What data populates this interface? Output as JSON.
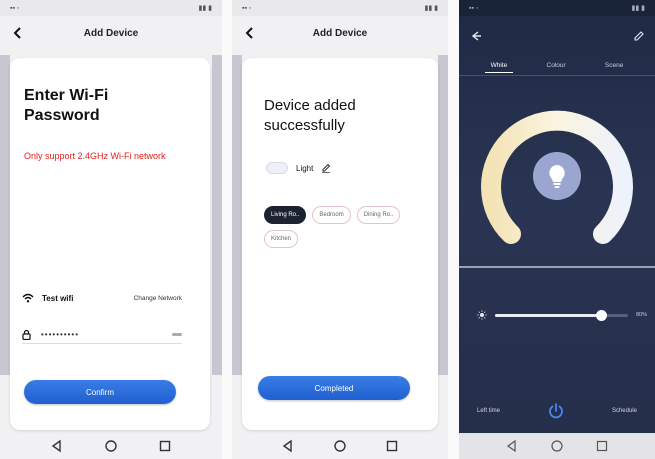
{
  "screen1": {
    "header_title": "Add Device",
    "title": "Enter Wi-Fi Password",
    "warning": "Only support 2.4GHz Wi-Fi network",
    "wifi_name": "Test wifi",
    "change_network": "Change Network",
    "password_value": "••••••••••",
    "confirm": "Confirm"
  },
  "screen2": {
    "header_title": "Add Device",
    "title": "Device added successfully",
    "device_name": "Light",
    "rooms": [
      "Living Ro..",
      "Bedroom",
      "Dining Ro..",
      "Kitchen"
    ],
    "selected_room": "Living Ro..",
    "completed": "Completed"
  },
  "screen3": {
    "tabs": [
      "White",
      "Colour",
      "Scene"
    ],
    "active_tab": "White",
    "brightness_percent": 80,
    "brightness_label": "80%",
    "left_action": "Left time",
    "right_action": "Schedule"
  },
  "colors": {
    "accent_blue": "#2b6ee0",
    "warning_red": "#e0211b",
    "dark_bg": "#242d48"
  },
  "icons": [
    "back-icon",
    "wifi-icon",
    "lock-icon",
    "eye-icon",
    "edit-icon",
    "bulb-icon",
    "power-icon",
    "sun-icon",
    "nav-back-icon",
    "nav-home-icon",
    "nav-recent-icon"
  ]
}
